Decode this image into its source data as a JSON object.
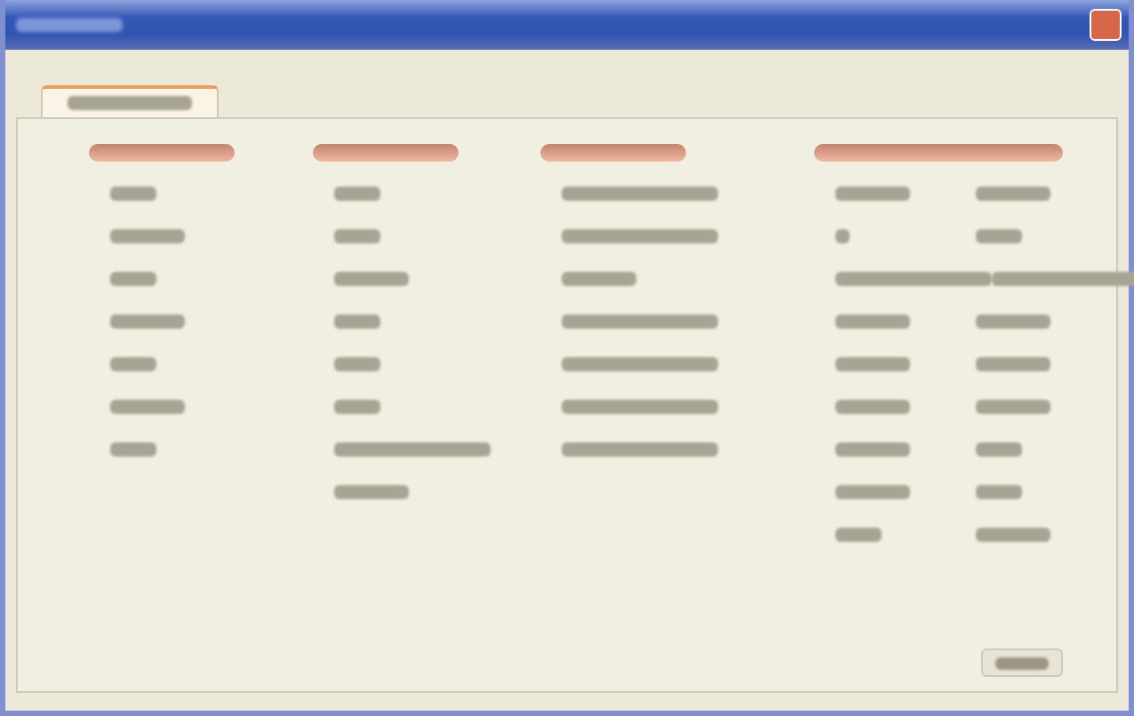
{
  "window": {
    "kind": "dialog",
    "close": {
      "kind": "close"
    }
  },
  "tabs": [
    {
      "kind": "blurred",
      "selected": true
    }
  ],
  "groups": [
    {
      "kind": "narrow",
      "rows": [
        {
          "cells": [
            {
              "kind": "short"
            }
          ]
        },
        {
          "cells": [
            {
              "kind": "medium"
            }
          ]
        },
        {
          "cells": [
            {
              "kind": "short"
            }
          ]
        },
        {
          "cells": [
            {
              "kind": "medium"
            }
          ]
        },
        {
          "cells": [
            {
              "kind": "short"
            }
          ]
        },
        {
          "cells": [
            {
              "kind": "medium"
            }
          ]
        },
        {
          "cells": [
            {
              "kind": "short"
            }
          ]
        }
      ]
    },
    {
      "kind": "narrow",
      "rows": [
        {
          "cells": [
            {
              "kind": "short"
            }
          ]
        },
        {
          "cells": [
            {
              "kind": "short"
            }
          ]
        },
        {
          "cells": [
            {
              "kind": "medium"
            }
          ]
        },
        {
          "cells": [
            {
              "kind": "short"
            }
          ]
        },
        {
          "cells": [
            {
              "kind": "short"
            }
          ]
        },
        {
          "cells": [
            {
              "kind": "short"
            }
          ]
        },
        {
          "cells": [
            {
              "kind": "long"
            }
          ]
        },
        {
          "cells": [
            {
              "kind": "medium"
            }
          ]
        }
      ]
    },
    {
      "kind": "narrow",
      "rows": [
        {
          "cells": [
            {
              "kind": "long"
            }
          ]
        },
        {
          "cells": [
            {
              "kind": "long"
            }
          ]
        },
        {
          "cells": [
            {
              "kind": "medium"
            }
          ]
        },
        {
          "cells": [
            {
              "kind": "long"
            }
          ]
        },
        {
          "cells": [
            {
              "kind": "long"
            }
          ]
        },
        {
          "cells": [
            {
              "kind": "long"
            }
          ]
        },
        {
          "cells": [
            {
              "kind": "long"
            }
          ]
        }
      ]
    },
    {
      "kind": "wide",
      "rows": [
        {
          "cells": [
            {
              "kind": "medium"
            },
            {
              "kind": "medium"
            }
          ]
        },
        {
          "cells": [
            {
              "kind": "tiny"
            },
            {
              "kind": "short"
            }
          ]
        },
        {
          "cells": [
            {
              "kind": "long"
            },
            {
              "kind": "long"
            }
          ]
        },
        {
          "cells": [
            {
              "kind": "medium"
            },
            {
              "kind": "medium"
            }
          ]
        },
        {
          "cells": [
            {
              "kind": "medium"
            },
            {
              "kind": "medium"
            }
          ]
        },
        {
          "cells": [
            {
              "kind": "medium"
            },
            {
              "kind": "medium"
            }
          ]
        },
        {
          "cells": [
            {
              "kind": "medium"
            },
            {
              "kind": "short"
            }
          ]
        },
        {
          "cells": [
            {
              "kind": "medium"
            },
            {
              "kind": "short"
            }
          ]
        },
        {
          "cells": [
            {
              "kind": "short"
            },
            {
              "kind": "medium"
            }
          ]
        }
      ]
    }
  ],
  "button": {
    "kind": "blurred"
  }
}
